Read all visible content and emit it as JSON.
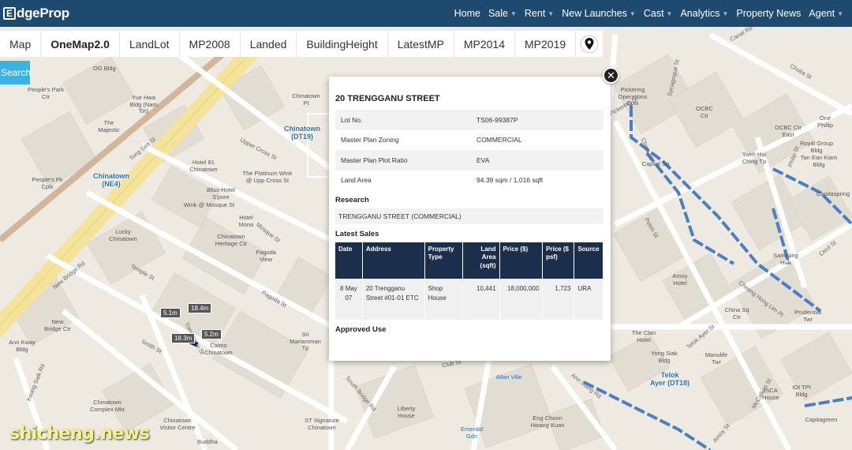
{
  "brand": {
    "logo_letter": "E",
    "name": "dgeProp"
  },
  "nav": [
    {
      "label": "Home",
      "has_caret": false
    },
    {
      "label": "Sale",
      "has_caret": true
    },
    {
      "label": "Rent",
      "has_caret": true
    },
    {
      "label": "New Launches",
      "has_caret": true
    },
    {
      "label": "Cast",
      "has_caret": true
    },
    {
      "label": "Analytics",
      "has_caret": true
    },
    {
      "label": "Property News",
      "has_caret": false
    },
    {
      "label": "Agent",
      "has_caret": true
    }
  ],
  "tabs": [
    "Map",
    "OneMap2.0",
    "LandLot",
    "MP2008",
    "Landed",
    "BuildingHeight",
    "LatestMP",
    "MP2014",
    "MP2019"
  ],
  "active_tab": "OneMap2.0",
  "search": {
    "label": "Search"
  },
  "popup": {
    "title": "20 TRENGGANU STREET",
    "details": [
      {
        "key": "Lot No.",
        "value": "TS06-99387P"
      },
      {
        "key": "Master Plan Zoning",
        "value": "COMMERCIAL"
      },
      {
        "key": "Master Plan Plot Ratio",
        "value": "EVA"
      },
      {
        "key": "Land Area",
        "value": "94.39 sqm / 1,016 sqft"
      }
    ],
    "research_heading": "Research",
    "research_value": "TRENGGANU STREET (COMMERCIAL)",
    "sales_heading": "Latest Sales",
    "sales_columns": [
      "Date",
      "Address",
      "Property Type",
      "Land Area (sqft)",
      "Price ($)",
      "Price ($ psf)",
      "Source"
    ],
    "sales_rows": [
      {
        "date": "8 May 07",
        "address": "20 Trengganu Street #01-01 ETC",
        "type": "Shop House",
        "area": "10,441",
        "price": "18,000,000",
        "psf": "1,723",
        "source": "URA"
      }
    ],
    "approved_heading": "Approved Use"
  },
  "map": {
    "stations": [
      {
        "name": "Chinatown",
        "code": "(NE4)"
      },
      {
        "name": "Chinatown",
        "code": "(DT19)"
      },
      {
        "name": "Telok",
        "code": "Ayer (DT18)"
      }
    ],
    "measurements": [
      "5.1m",
      "18.4m",
      "18.3m",
      "5.2m"
    ],
    "labels": [
      "OG Bldg",
      "People's Park Ctr",
      "Yue Hwa Bldg (Nam Tin)",
      "The Majestic",
      "People's Pk Cplx",
      "Hotel 81 Chinatown",
      "Bliss-Hotel S'pore",
      "The Platinum Wink @ Upp Cross St",
      "Chinatown Pt",
      "Pickering Operations Cplx",
      "OCBC Ctr",
      "OCBC Ctr East",
      "One Phillip",
      "Royal Group Bldg",
      "Yueh Hai Ching Tp",
      "Tan Ean Kiam Bldg",
      "Capitaspring",
      "Capital Sq",
      "Samsung Hub",
      "Amoy Hotel",
      "Prudential Twr",
      "China Sq Ctr",
      "The Clan Hotel",
      "Manulife Twr",
      "Yong Siak Bldg",
      "ISCA House",
      "IOI TPI Bldg",
      "Capitagreen",
      "Eng Choon Hwang Kuan",
      "Liberty House",
      "ST Signature Chinatown",
      "Chinatown Visitor Centre",
      "Chinatown Complex Mkt",
      "New Bridge Ctr",
      "Ann Kway Bldg",
      "Lucky Chinatown",
      "Chinatown Heritage Ctr",
      "Pagoda View",
      "Hotel Mono",
      "Sri Mariamman Tp",
      "Calmo Chinatown",
      "Wink @ Mosque St",
      "Buddha",
      "Emerald Gdn",
      "Allan Ville"
    ],
    "roads": [
      "Tong Sen St",
      "Upper Cross St",
      "New Bridge Rd",
      "Temple St",
      "Pagoda St",
      "Mosque St",
      "Smith St",
      "Trengganu St",
      "Keong Saik Rd",
      "South Bridge Rd",
      "Club St",
      "Ann Siang Rd",
      "Synagogue St",
      "Chulia St",
      "Canal Rd",
      "Pickering St",
      "China St",
      "Pekin St",
      "Philip St",
      "Cheang Hong Lim Pl",
      "Telok Ayer St",
      "Cecil St",
      "Amoy St",
      "McCallum St"
    ]
  },
  "watermark": "shicheng.news"
}
